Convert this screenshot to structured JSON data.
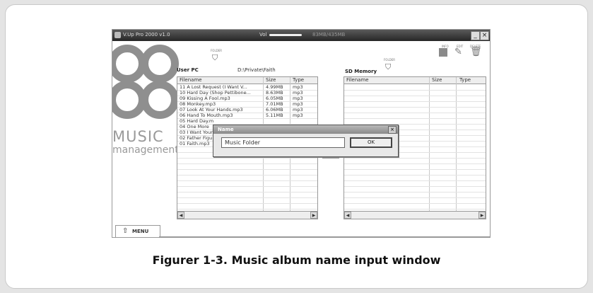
{
  "app": {
    "title": "V.Up Pro 2000 v1.0",
    "volume_label": "Vol",
    "storage": "83MB/435MB",
    "minimize": "_",
    "close": "×"
  },
  "logo": {
    "line1": "MUSIC",
    "line2": "management"
  },
  "left_panel": {
    "folder_label": "FOLDER",
    "title": "User PC",
    "path": "D:\\Private\\Faith",
    "columns": [
      "Filename",
      "Size",
      "Type"
    ],
    "rows": [
      {
        "name": "11 A Lost Request (I Want V...",
        "size": "4.99MB",
        "type": "mp3"
      },
      {
        "name": "10 Hard Day (Shop Pettibone...",
        "size": "8.63MB",
        "type": "mp3"
      },
      {
        "name": "09 Kissing A Fool.mp3",
        "size": "6.05MB",
        "type": "mp3"
      },
      {
        "name": "08 Monkey.mp3",
        "size": "7.01MB",
        "type": "mp3"
      },
      {
        "name": "07 Look At Your Hands.mp3",
        "size": "6.06MB",
        "type": "mp3"
      },
      {
        "name": "06 Hand To Mouth.mp3",
        "size": "5.11MB",
        "type": "mp3"
      },
      {
        "name": "05 Hard Day.m",
        "size": "",
        "type": ""
      },
      {
        "name": "04 One More",
        "size": "",
        "type": ""
      },
      {
        "name": "03 I Want Your",
        "size": "",
        "type": ""
      },
      {
        "name": "02 Father Figu",
        "size": "",
        "type": ""
      },
      {
        "name": "01 Faith.mp3",
        "size": "",
        "type": ""
      }
    ]
  },
  "right_panel": {
    "folder_label": "FOLDER",
    "title": "SD Memory",
    "columns": [
      "Filename",
      "Size",
      "Type"
    ]
  },
  "toolbar": {
    "labels": [
      "INFO",
      "EDIT",
      "DELETE"
    ]
  },
  "dialog": {
    "title": "Name",
    "close": "×",
    "input_value": "Music Folder",
    "ok_label": "OK"
  },
  "menu_tab": {
    "label": "MENU"
  },
  "caption": "Figurer 1-3. Music album name input window"
}
